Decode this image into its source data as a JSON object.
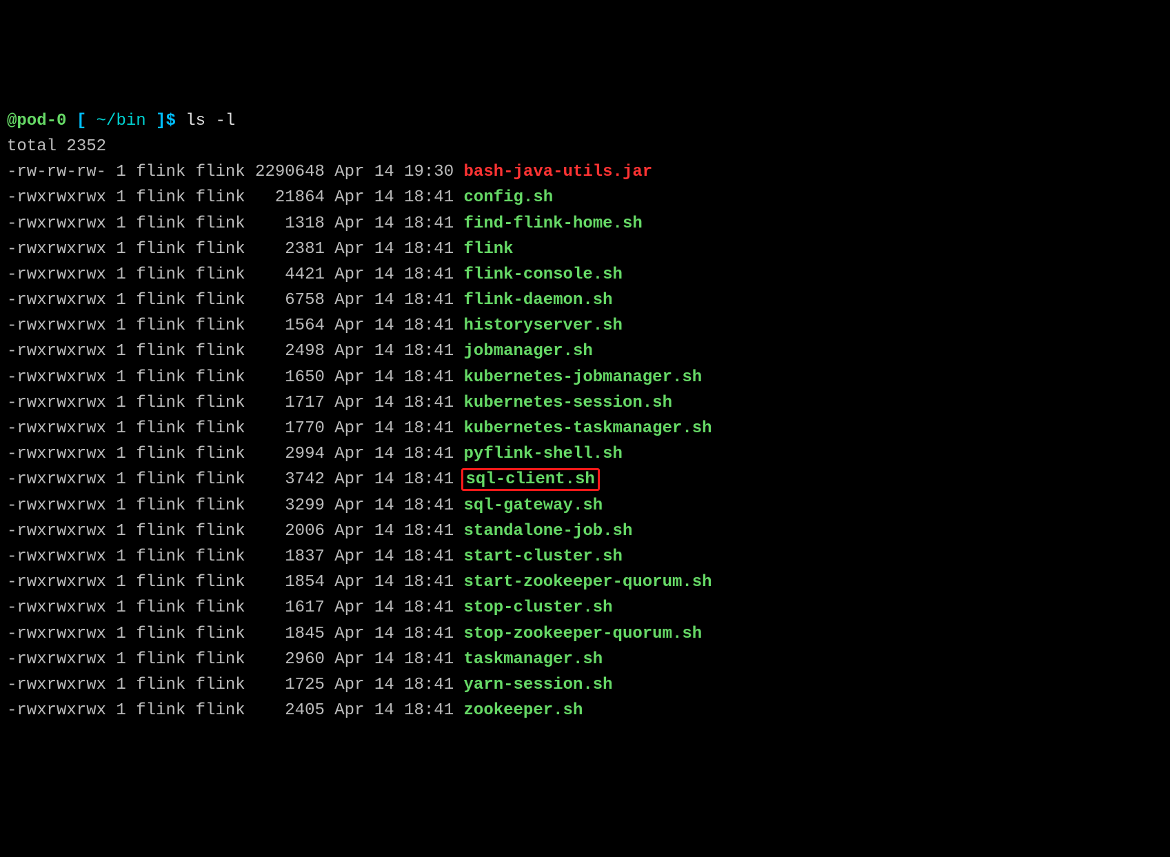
{
  "prompt": {
    "host": "@pod-0",
    "bracket_open": " [ ",
    "cwd": "~/bin",
    "bracket_close": " ]",
    "dollar": "$ ",
    "command": "ls -l"
  },
  "total_line": "total 2352",
  "files": [
    {
      "perms": "-rw-rw-rw-",
      "links": "1",
      "owner": "flink",
      "group": "flink",
      "size": "2290648",
      "month": "Apr",
      "day": "14",
      "time": "19:30",
      "name": "bash-java-utils.jar",
      "color": "red",
      "highlight": false
    },
    {
      "perms": "-rwxrwxrwx",
      "links": "1",
      "owner": "flink",
      "group": "flink",
      "size": "21864",
      "month": "Apr",
      "day": "14",
      "time": "18:41",
      "name": "config.sh",
      "color": "green",
      "highlight": false
    },
    {
      "perms": "-rwxrwxrwx",
      "links": "1",
      "owner": "flink",
      "group": "flink",
      "size": "1318",
      "month": "Apr",
      "day": "14",
      "time": "18:41",
      "name": "find-flink-home.sh",
      "color": "green",
      "highlight": false
    },
    {
      "perms": "-rwxrwxrwx",
      "links": "1",
      "owner": "flink",
      "group": "flink",
      "size": "2381",
      "month": "Apr",
      "day": "14",
      "time": "18:41",
      "name": "flink",
      "color": "green",
      "highlight": false
    },
    {
      "perms": "-rwxrwxrwx",
      "links": "1",
      "owner": "flink",
      "group": "flink",
      "size": "4421",
      "month": "Apr",
      "day": "14",
      "time": "18:41",
      "name": "flink-console.sh",
      "color": "green",
      "highlight": false
    },
    {
      "perms": "-rwxrwxrwx",
      "links": "1",
      "owner": "flink",
      "group": "flink",
      "size": "6758",
      "month": "Apr",
      "day": "14",
      "time": "18:41",
      "name": "flink-daemon.sh",
      "color": "green",
      "highlight": false
    },
    {
      "perms": "-rwxrwxrwx",
      "links": "1",
      "owner": "flink",
      "group": "flink",
      "size": "1564",
      "month": "Apr",
      "day": "14",
      "time": "18:41",
      "name": "historyserver.sh",
      "color": "green",
      "highlight": false
    },
    {
      "perms": "-rwxrwxrwx",
      "links": "1",
      "owner": "flink",
      "group": "flink",
      "size": "2498",
      "month": "Apr",
      "day": "14",
      "time": "18:41",
      "name": "jobmanager.sh",
      "color": "green",
      "highlight": false
    },
    {
      "perms": "-rwxrwxrwx",
      "links": "1",
      "owner": "flink",
      "group": "flink",
      "size": "1650",
      "month": "Apr",
      "day": "14",
      "time": "18:41",
      "name": "kubernetes-jobmanager.sh",
      "color": "green",
      "highlight": false
    },
    {
      "perms": "-rwxrwxrwx",
      "links": "1",
      "owner": "flink",
      "group": "flink",
      "size": "1717",
      "month": "Apr",
      "day": "14",
      "time": "18:41",
      "name": "kubernetes-session.sh",
      "color": "green",
      "highlight": false
    },
    {
      "perms": "-rwxrwxrwx",
      "links": "1",
      "owner": "flink",
      "group": "flink",
      "size": "1770",
      "month": "Apr",
      "day": "14",
      "time": "18:41",
      "name": "kubernetes-taskmanager.sh",
      "color": "green",
      "highlight": false
    },
    {
      "perms": "-rwxrwxrwx",
      "links": "1",
      "owner": "flink",
      "group": "flink",
      "size": "2994",
      "month": "Apr",
      "day": "14",
      "time": "18:41",
      "name": "pyflink-shell.sh",
      "color": "green",
      "highlight": false
    },
    {
      "perms": "-rwxrwxrwx",
      "links": "1",
      "owner": "flink",
      "group": "flink",
      "size": "3742",
      "month": "Apr",
      "day": "14",
      "time": "18:41",
      "name": "sql-client.sh",
      "color": "green",
      "highlight": true
    },
    {
      "perms": "-rwxrwxrwx",
      "links": "1",
      "owner": "flink",
      "group": "flink",
      "size": "3299",
      "month": "Apr",
      "day": "14",
      "time": "18:41",
      "name": "sql-gateway.sh",
      "color": "green",
      "highlight": false
    },
    {
      "perms": "-rwxrwxrwx",
      "links": "1",
      "owner": "flink",
      "group": "flink",
      "size": "2006",
      "month": "Apr",
      "day": "14",
      "time": "18:41",
      "name": "standalone-job.sh",
      "color": "green",
      "highlight": false
    },
    {
      "perms": "-rwxrwxrwx",
      "links": "1",
      "owner": "flink",
      "group": "flink",
      "size": "1837",
      "month": "Apr",
      "day": "14",
      "time": "18:41",
      "name": "start-cluster.sh",
      "color": "green",
      "highlight": false
    },
    {
      "perms": "-rwxrwxrwx",
      "links": "1",
      "owner": "flink",
      "group": "flink",
      "size": "1854",
      "month": "Apr",
      "day": "14",
      "time": "18:41",
      "name": "start-zookeeper-quorum.sh",
      "color": "green",
      "highlight": false
    },
    {
      "perms": "-rwxrwxrwx",
      "links": "1",
      "owner": "flink",
      "group": "flink",
      "size": "1617",
      "month": "Apr",
      "day": "14",
      "time": "18:41",
      "name": "stop-cluster.sh",
      "color": "green",
      "highlight": false
    },
    {
      "perms": "-rwxrwxrwx",
      "links": "1",
      "owner": "flink",
      "group": "flink",
      "size": "1845",
      "month": "Apr",
      "day": "14",
      "time": "18:41",
      "name": "stop-zookeeper-quorum.sh",
      "color": "green",
      "highlight": false
    },
    {
      "perms": "-rwxrwxrwx",
      "links": "1",
      "owner": "flink",
      "group": "flink",
      "size": "2960",
      "month": "Apr",
      "day": "14",
      "time": "18:41",
      "name": "taskmanager.sh",
      "color": "green",
      "highlight": false
    },
    {
      "perms": "-rwxrwxrwx",
      "links": "1",
      "owner": "flink",
      "group": "flink",
      "size": "1725",
      "month": "Apr",
      "day": "14",
      "time": "18:41",
      "name": "yarn-session.sh",
      "color": "green",
      "highlight": false
    },
    {
      "perms": "-rwxrwxrwx",
      "links": "1",
      "owner": "flink",
      "group": "flink",
      "size": "2405",
      "month": "Apr",
      "day": "14",
      "time": "18:41",
      "name": "zookeeper.sh",
      "color": "green",
      "highlight": false
    }
  ]
}
